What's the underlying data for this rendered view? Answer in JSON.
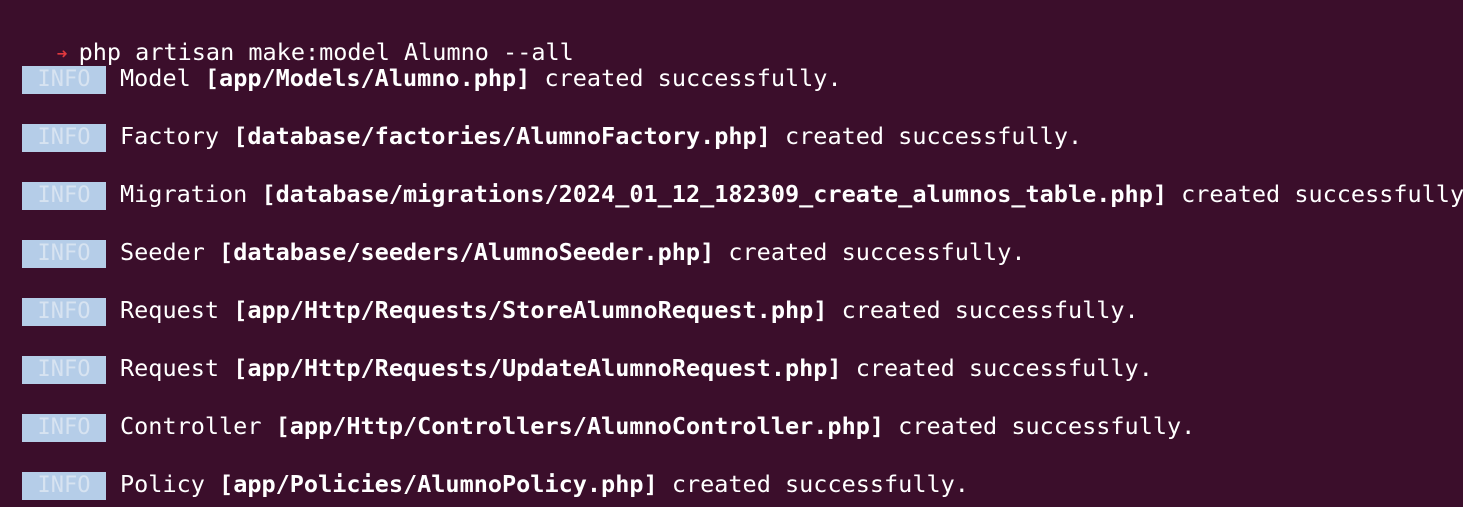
{
  "prompt": {
    "arrow": "➜",
    "command": "php artisan make:model Alumno --all"
  },
  "badge_label": "INFO",
  "lines": [
    {
      "type": "Model",
      "path": "[app/Models/Alumno.php]",
      "message": "created successfully."
    },
    {
      "type": "Factory",
      "path": "[database/factories/AlumnoFactory.php]",
      "message": "created successfully."
    },
    {
      "type": "Migration",
      "path": "[database/migrations/2024_01_12_182309_create_alumnos_table.php]",
      "message": "created successfully."
    },
    {
      "type": "Seeder",
      "path": "[database/seeders/AlumnoSeeder.php]",
      "message": "created successfully."
    },
    {
      "type": "Request",
      "path": "[app/Http/Requests/StoreAlumnoRequest.php]",
      "message": "created successfully."
    },
    {
      "type": "Request",
      "path": "[app/Http/Requests/UpdateAlumnoRequest.php]",
      "message": "created successfully."
    },
    {
      "type": "Controller",
      "path": "[app/Http/Controllers/AlumnoController.php]",
      "message": "created successfully."
    },
    {
      "type": "Policy",
      "path": "[app/Policies/AlumnoPolicy.php]",
      "message": "created successfully."
    }
  ],
  "colors": {
    "background": "#3b0e2b",
    "text": "#ffffff",
    "arrow": "#e0383e",
    "badge_bg": "#b5cde8"
  }
}
